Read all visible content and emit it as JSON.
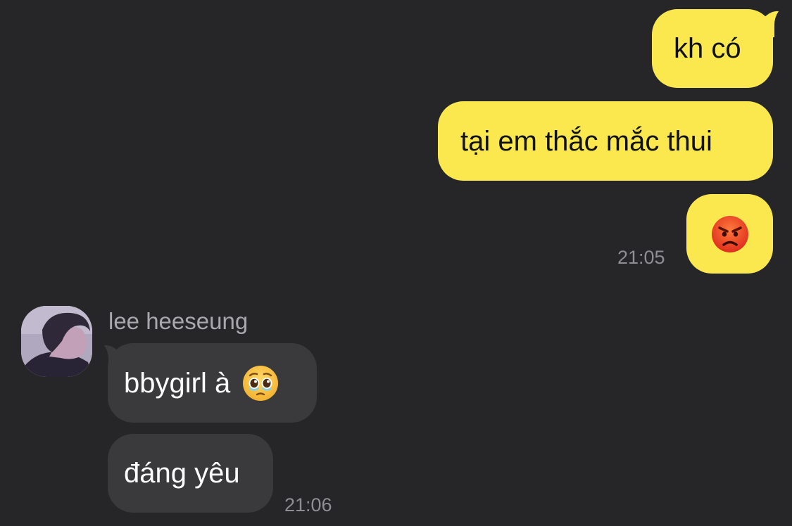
{
  "messages_out": [
    {
      "text": "kh có"
    },
    {
      "text": "tại em thắc mắc thui"
    },
    {
      "text": "😡",
      "icon": "angry-face-emoji"
    }
  ],
  "messages_out_time": "21:05",
  "incoming": {
    "sender": "lee heeseung",
    "avatar": "profile-photo",
    "messages": [
      {
        "text": "bbygirl à",
        "emoji": "🥹",
        "emoji_icon": "holding-back-tears-emoji"
      },
      {
        "text": "đáng yêu"
      }
    ],
    "time": "21:06"
  },
  "colors": {
    "background": "#262628",
    "outgoing_bubble": "#fae84e",
    "incoming_bubble": "#3a3a3c",
    "timestamp": "#8e8e93",
    "sender_name": "#a9a9ad"
  }
}
